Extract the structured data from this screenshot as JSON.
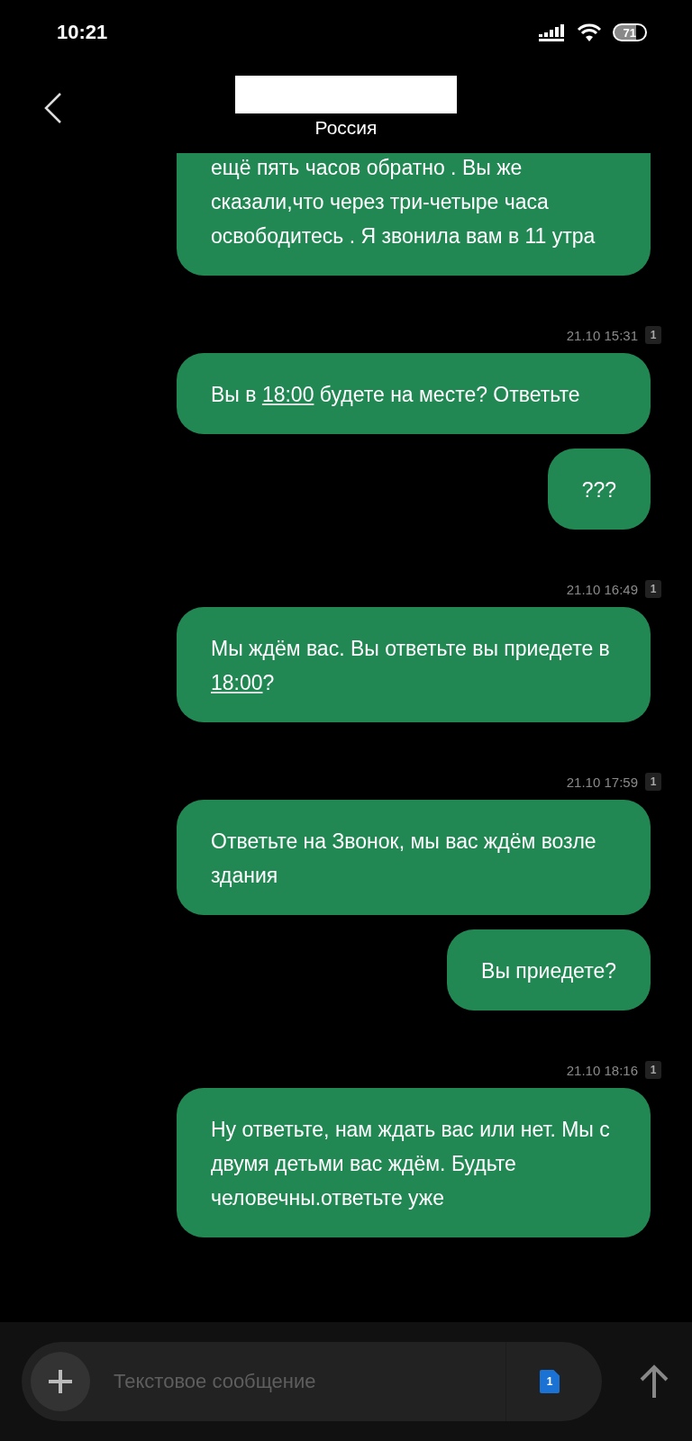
{
  "status_bar": {
    "time": "10:21",
    "battery": "71"
  },
  "header": {
    "subtitle": "Россия"
  },
  "messages": [
    {
      "kind": "message",
      "parts": [
        {
          "text": "ещё пять часов обратно . Вы же сказали,что через три-четыре часа освободитесь . Я звонила вам в 11 утра"
        }
      ]
    },
    {
      "kind": "timestamp",
      "text": "21.10 15:31",
      "sim": "1"
    },
    {
      "kind": "message",
      "parts": [
        {
          "text": "Вы в "
        },
        {
          "text": "18:00",
          "link": true
        },
        {
          "text": " будете на месте? Ответьте"
        }
      ]
    },
    {
      "kind": "message",
      "parts": [
        {
          "text": "???"
        }
      ]
    },
    {
      "kind": "timestamp",
      "text": "21.10 16:49",
      "sim": "1"
    },
    {
      "kind": "message",
      "parts": [
        {
          "text": "Мы ждём вас. Вы ответьте вы приедете в "
        },
        {
          "text": "18:00",
          "link": true
        },
        {
          "text": "?"
        }
      ]
    },
    {
      "kind": "timestamp",
      "text": "21.10 17:59",
      "sim": "1"
    },
    {
      "kind": "message",
      "parts": [
        {
          "text": "Ответьте на Звонок, мы вас ждём возле здания"
        }
      ]
    },
    {
      "kind": "message",
      "parts": [
        {
          "text": "Вы приедете?"
        }
      ]
    },
    {
      "kind": "timestamp",
      "text": "21.10 18:16",
      "sim": "1"
    },
    {
      "kind": "message",
      "parts": [
        {
          "text": "Ну ответьте, нам ждать вас или нет. Мы с двумя детьми вас ждём. Будьте человечны.ответьте уже"
        }
      ]
    }
  ],
  "composer": {
    "placeholder": "Текстовое сообщение",
    "sim": "1"
  }
}
